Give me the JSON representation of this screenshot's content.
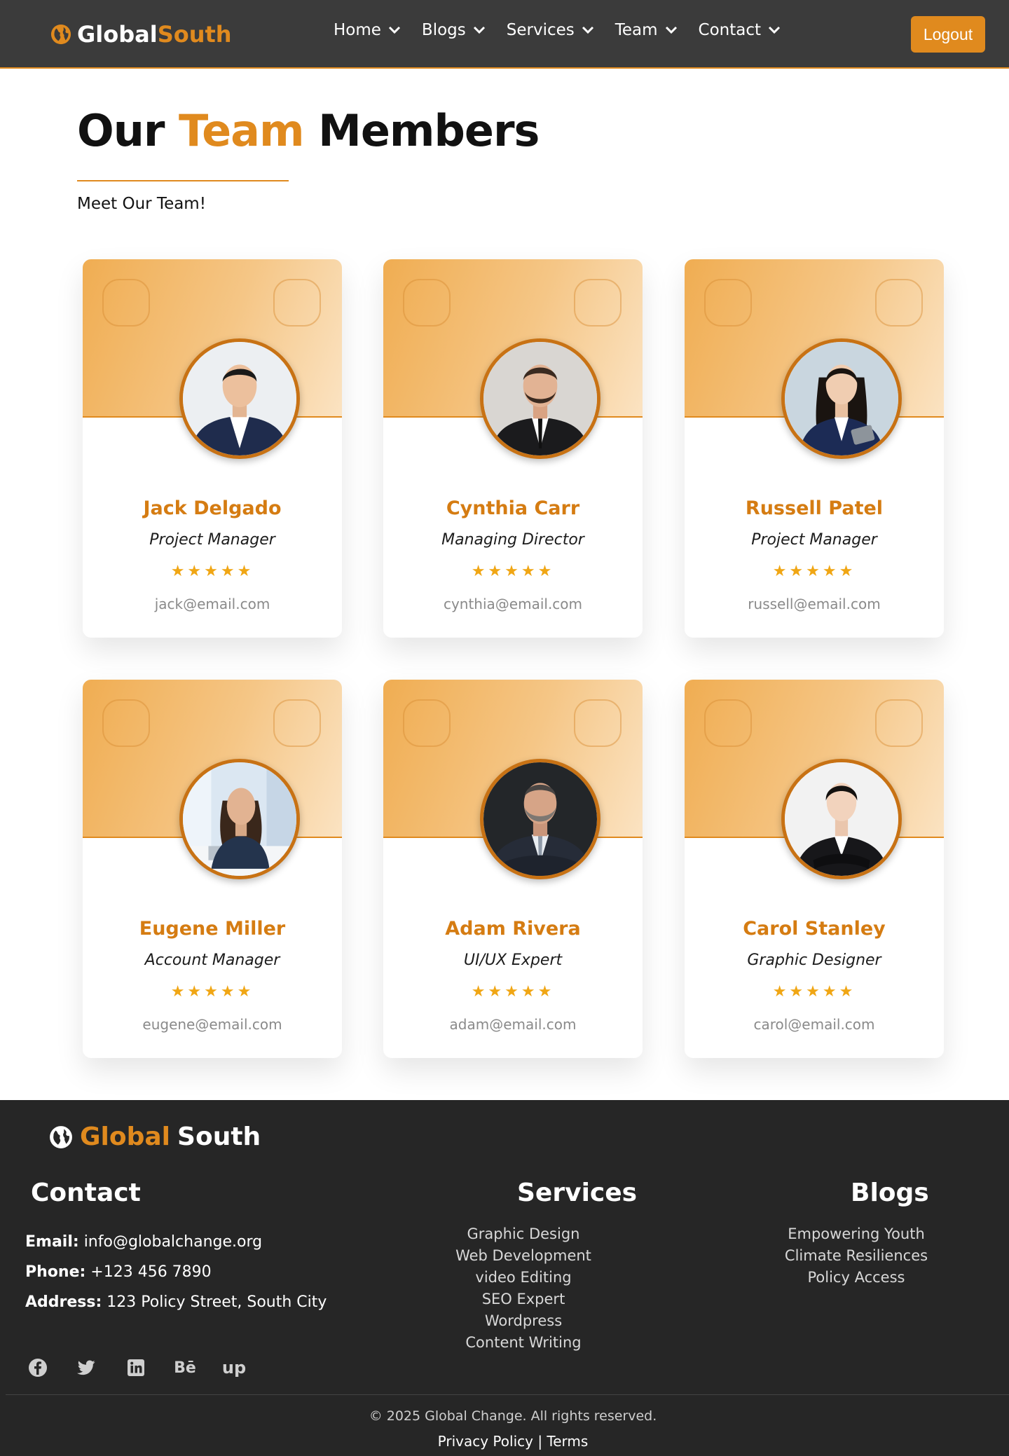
{
  "brand": {
    "part1": "Global",
    "part2": "South"
  },
  "nav": {
    "items": [
      {
        "label": "Home"
      },
      {
        "label": "Blogs"
      },
      {
        "label": "Services"
      },
      {
        "label": "Team"
      },
      {
        "label": "Contact"
      }
    ],
    "logout_label": "Logout"
  },
  "hero": {
    "title_part1": "Our",
    "title_accent": "Team",
    "title_part2": "Members",
    "subtitle": "Meet Our Team!"
  },
  "team": [
    {
      "name": "Jack Delgado",
      "role": "Project Manager",
      "rating": "★★★★★",
      "email": "jack@email.com",
      "photo": "man-asian-navy-suit"
    },
    {
      "name": "Cynthia Carr",
      "role": "Managing Director",
      "rating": "★★★★★",
      "email": "cynthia@email.com",
      "photo": "man-beard-black-suit"
    },
    {
      "name": "Russell Patel",
      "role": "Project Manager",
      "rating": "★★★★★",
      "email": "russell@email.com",
      "photo": "woman-navy-suit-tablet"
    },
    {
      "name": "Eugene Miller",
      "role": "Account Manager",
      "rating": "★★★★★",
      "email": "eugene@email.com",
      "photo": "woman-laptop-office"
    },
    {
      "name": "Adam Rivera",
      "role": "UI/UX Expert",
      "rating": "★★★★★",
      "email": "adam@email.com",
      "photo": "man-grey-beard-suit"
    },
    {
      "name": "Carol Stanley",
      "role": "Graphic Designer",
      "rating": "★★★★★",
      "email": "carol@email.com",
      "photo": "woman-black-suit-arms-crossed"
    }
  ],
  "footer": {
    "brand_part1": "Global",
    "brand_part2": "South",
    "contact_heading": "Contact",
    "email_label": "Email:",
    "email_value": "info@globalchange.org",
    "phone_label": "Phone:",
    "phone_value": "+123 456 7890",
    "address_label": "Address:",
    "address_value": "123 Policy Street, South City",
    "services_heading": "Services",
    "services": [
      "Graphic Design",
      "Web Development",
      "video Editing",
      "SEO Expert",
      "Wordpress",
      "Content Writing"
    ],
    "blogs_heading": "Blogs",
    "blogs": [
      "Empowering Youth",
      "Climate Resiliences",
      "Policy Access"
    ],
    "socials": [
      "facebook-icon",
      "twitter-icon",
      "linkedin-icon",
      "behance-icon",
      "upwork-icon"
    ],
    "behance_text": "Bē",
    "upwork_text": "up",
    "copyright": "© 2025 Global Change. All rights reserved.",
    "privacy_label": "Privacy Policy",
    "separator": " | ",
    "terms_label": "Terms"
  },
  "colors": {
    "accent": "#e08a1e",
    "nav_bg": "#3b3b3b",
    "footer_bg": "#262626",
    "star": "#f0a614"
  }
}
